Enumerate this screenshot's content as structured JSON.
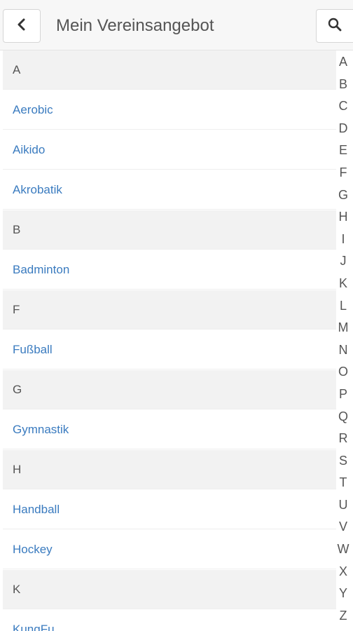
{
  "header": {
    "title": "Mein Vereinsangebot",
    "back_icon": "chevron-left-icon",
    "search_icon": "search-icon"
  },
  "list": [
    {
      "type": "header",
      "label": "A"
    },
    {
      "type": "item",
      "label": "Aerobic"
    },
    {
      "type": "item",
      "label": "Aikido"
    },
    {
      "type": "item",
      "label": "Akrobatik"
    },
    {
      "type": "header",
      "label": "B"
    },
    {
      "type": "item",
      "label": "Badminton"
    },
    {
      "type": "header",
      "label": "F"
    },
    {
      "type": "item",
      "label": "Fußball"
    },
    {
      "type": "header",
      "label": "G"
    },
    {
      "type": "item",
      "label": "Gymnastik"
    },
    {
      "type": "header",
      "label": "H"
    },
    {
      "type": "item",
      "label": "Handball"
    },
    {
      "type": "item",
      "label": "Hockey"
    },
    {
      "type": "header",
      "label": "K"
    },
    {
      "type": "item",
      "label": "KungFu"
    }
  ],
  "index": [
    "A",
    "B",
    "C",
    "D",
    "E",
    "F",
    "G",
    "H",
    "I",
    "J",
    "K",
    "L",
    "M",
    "N",
    "O",
    "P",
    "Q",
    "R",
    "S",
    "T",
    "U",
    "V",
    "W",
    "X",
    "Y",
    "Z"
  ],
  "colors": {
    "link": "#3a7bbf",
    "section_bg": "#f2f2f2",
    "header_bg": "#f7f7f7"
  }
}
